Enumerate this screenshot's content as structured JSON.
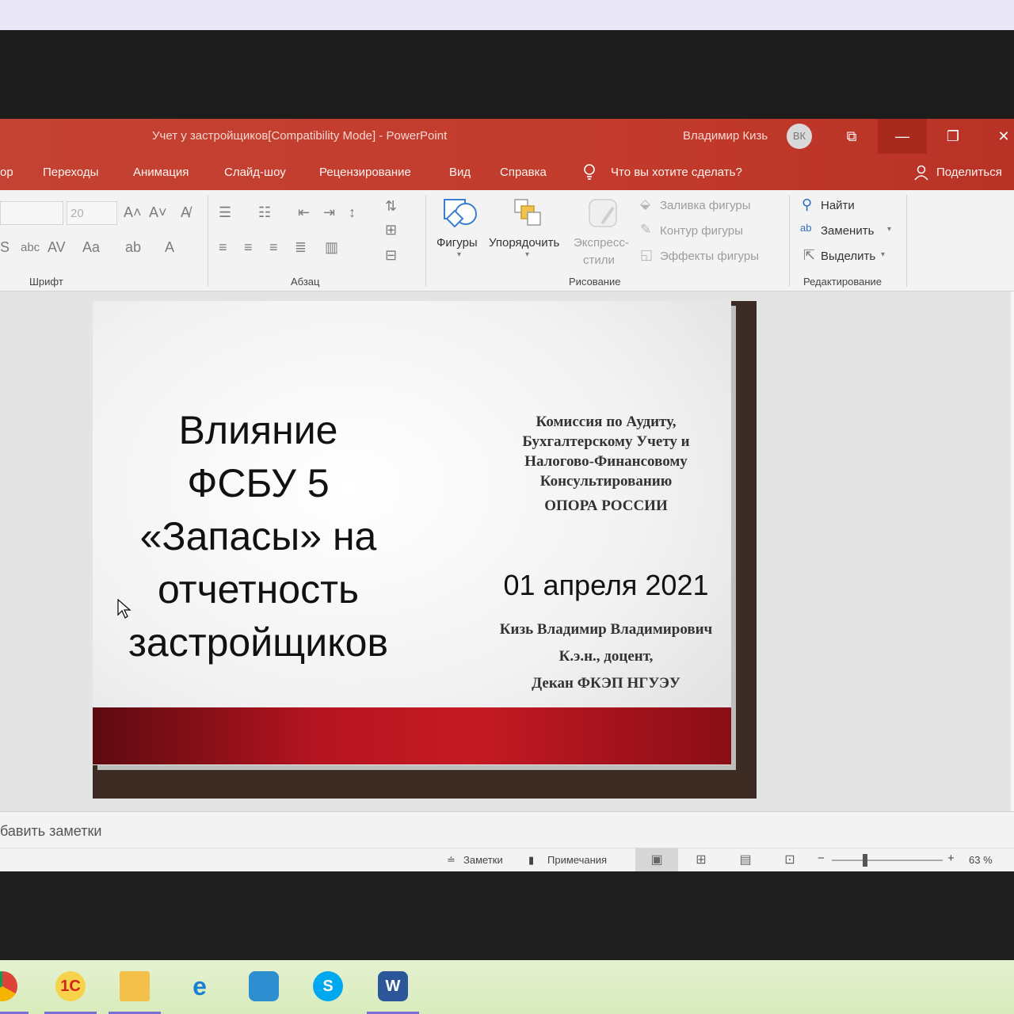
{
  "window": {
    "title": "Учет у застройщиков[Compatibility Mode]  -  PowerPoint",
    "user_name": "Владимир Кизь",
    "user_initials": "ВК"
  },
  "menu": {
    "items": [
      "ор",
      "Переходы",
      "Анимация",
      "Слайд-шоу",
      "Рецензирование",
      "Вид",
      "Справка"
    ],
    "tell_me": "Что вы хотите сделать?",
    "share": "Поделиться"
  },
  "ribbon": {
    "font_size": "20",
    "groups": {
      "font": "Шрифт",
      "paragraph": "Абзац",
      "drawing": "Рисование",
      "editing": "Редактирование"
    },
    "drawing": {
      "shapes": "Фигуры",
      "arrange": "Упорядочить",
      "quick_styles_1": "Экспресс-",
      "quick_styles_2": "стили",
      "fill": "Заливка фигуры",
      "outline": "Контур фигуры",
      "effects": "Эффекты фигуры"
    },
    "editing": {
      "find": "Найти",
      "replace": "Заменить",
      "select": "Выделить"
    }
  },
  "slide": {
    "title_lines": [
      "Влияние",
      "ФСБУ 5",
      "«Запасы» на",
      "отчетность",
      "застройщиков"
    ],
    "org_lines": [
      "Комиссия по Аудиту,",
      "Бухгалтерскому Учету и",
      "Налогово-Финансовому",
      "Консультированию"
    ],
    "org_name": "ОПОРА РОССИИ",
    "date": "01 апреля 2021",
    "author_lines": [
      "Кизь Владимир Владимирович",
      "К.э.н., доцент,",
      "Декан ФКЭП НГУЭУ"
    ]
  },
  "notes": {
    "placeholder": "бавить заметки"
  },
  "statusbar": {
    "notes": "Заметки",
    "comments": "Примечания",
    "zoom": "63 %",
    "zoom_fraction": 0.3
  },
  "taskbar": {
    "apps": [
      "chrome-icon",
      "1c-icon",
      "file-explorer-icon",
      "internet-explorer-icon",
      "remote-desktop-icon",
      "skype-icon",
      "word-icon"
    ],
    "labels": {
      "onec": "1С",
      "skype": "S",
      "word": "W"
    }
  }
}
